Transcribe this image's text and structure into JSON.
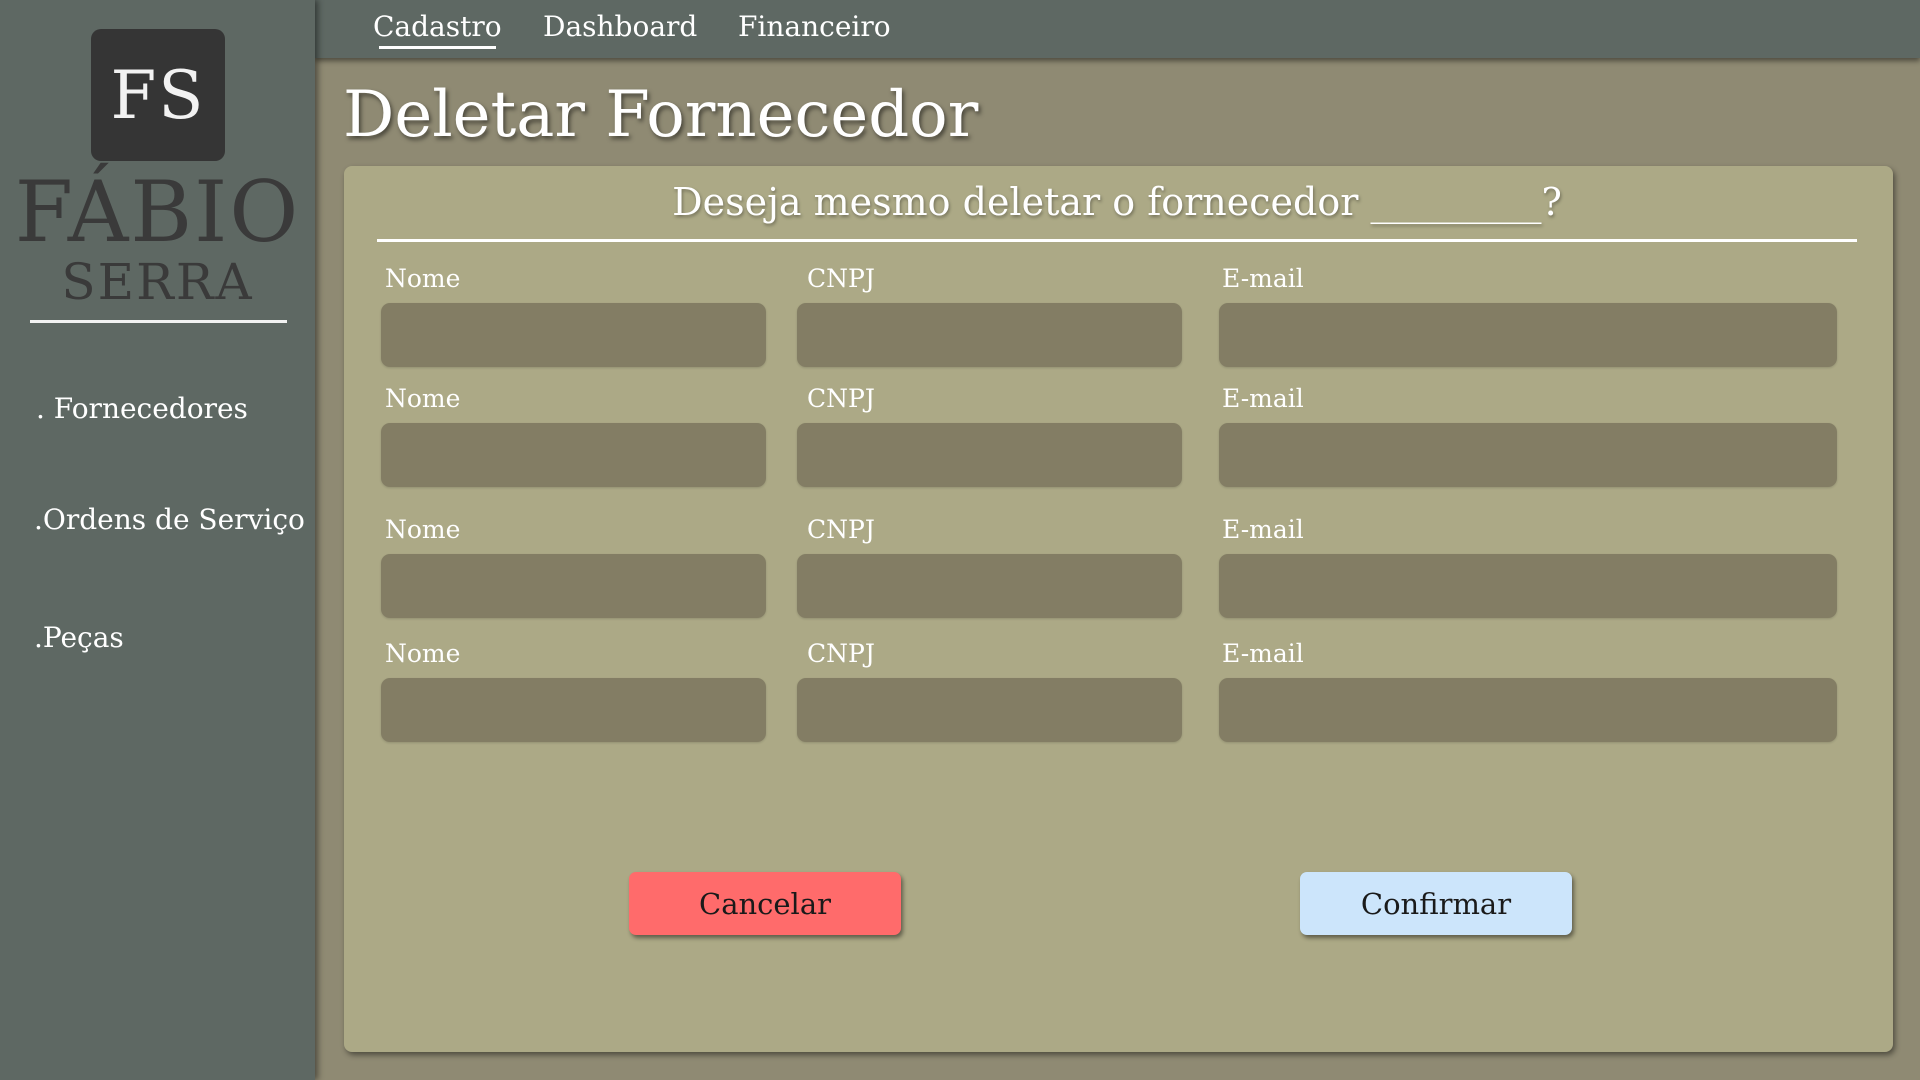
{
  "sidebar": {
    "logo_initials": "FS",
    "brand_name": "FÁBIO",
    "brand_sub": "SERRA",
    "items": [
      {
        "label": ". Fornecedores"
      },
      {
        "label": ".Ordens de Serviço"
      },
      {
        "label": ".Peças"
      }
    ]
  },
  "topnav": {
    "tabs": [
      {
        "label": "Cadastro",
        "active": true
      },
      {
        "label": "Dashboard",
        "active": false
      },
      {
        "label": "Financeiro",
        "active": false
      }
    ]
  },
  "page": {
    "title": "Deletar Fornecedor"
  },
  "dialog": {
    "question": "Deseja mesmo deletar o fornecedor _________?",
    "rows": [
      {
        "nome_label": "Nome",
        "cnpj_label": "CNPJ",
        "email_label": "E-mail",
        "nome": "",
        "cnpj": "",
        "email": ""
      },
      {
        "nome_label": "Nome",
        "cnpj_label": "CNPJ",
        "email_label": "E-mail",
        "nome": "",
        "cnpj": "",
        "email": ""
      },
      {
        "nome_label": "Nome",
        "cnpj_label": "CNPJ",
        "email_label": "E-mail",
        "nome": "",
        "cnpj": "",
        "email": ""
      },
      {
        "nome_label": "Nome",
        "cnpj_label": "CNPJ",
        "email_label": "E-mail",
        "nome": "",
        "cnpj": "",
        "email": ""
      }
    ],
    "cancel_label": "Cancelar",
    "confirm_label": "Confirmar"
  },
  "colors": {
    "sidebar_bg": "#5e6863",
    "page_bg": "#8f8a73",
    "card_bg": "#aca986",
    "input_bg": "#837d64",
    "cancel_bg": "#ff6b6b",
    "confirm_bg": "#cce5fb"
  }
}
